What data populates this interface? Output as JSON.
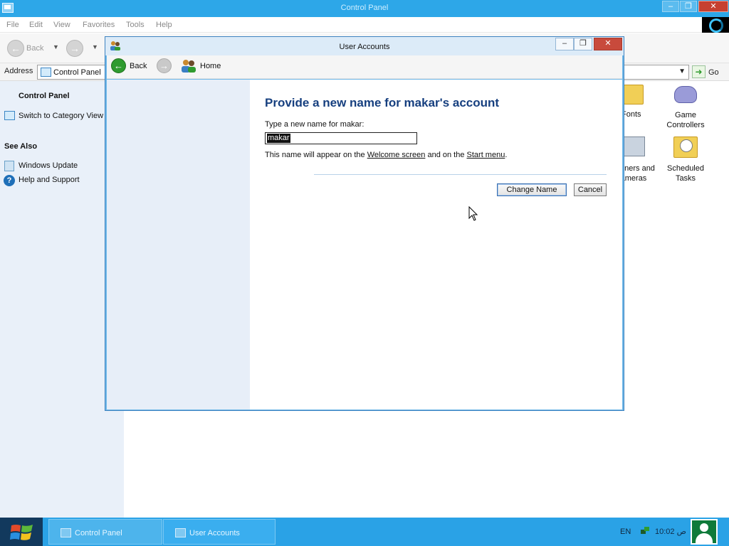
{
  "control_panel": {
    "title": "Control Panel",
    "menu": [
      "File",
      "Edit",
      "View",
      "Favorites",
      "Tools",
      "Help"
    ],
    "toolbar": {
      "back_label": "Back"
    },
    "address": {
      "label": "Address",
      "value": "Control Panel",
      "go_label": "Go"
    },
    "left_pane": {
      "title": "Control Panel",
      "switch_view": "Switch to Category View",
      "see_also_title": "See Also",
      "see_also": [
        "Windows Update",
        "Help and Support"
      ]
    },
    "items": {
      "fonts": "Fonts",
      "game_controllers": "Game Controllers",
      "scanners_cameras": "Scanners and Cameras",
      "scheduled_tasks": "Scheduled Tasks"
    }
  },
  "user_accounts": {
    "title": "User Accounts",
    "nav": {
      "back_label": "Back",
      "home_label": "Home"
    },
    "heading": "Provide a new name for makar's account",
    "prompt": "Type a new name for makar:",
    "name_value": "makar",
    "note": {
      "prefix": "This name will appear on the ",
      "welcome_link": "Welcome screen",
      "middle": " and on the ",
      "start_link": "Start menu",
      "suffix": "."
    },
    "buttons": {
      "change_name": "Change Name",
      "cancel": "Cancel"
    }
  },
  "taskbar": {
    "tasks": [
      "Control Panel",
      "User Accounts"
    ],
    "language": "EN",
    "clock": "10:02 ص"
  },
  "colors": {
    "titlebar_blue": "#2da7e8",
    "heading_blue": "#163f7f",
    "taskbar_blue": "#2aa2e6",
    "close_red": "#c84a3c"
  },
  "icons": {
    "cp_app": "control-panel-icon",
    "ua_app": "user-accounts-icon",
    "fonts": "fonts-folder-icon",
    "game": "game-controller-icon",
    "scanner": "scanner-camera-icon",
    "tasks": "scheduled-tasks-icon",
    "start": "windows-logo-icon"
  }
}
